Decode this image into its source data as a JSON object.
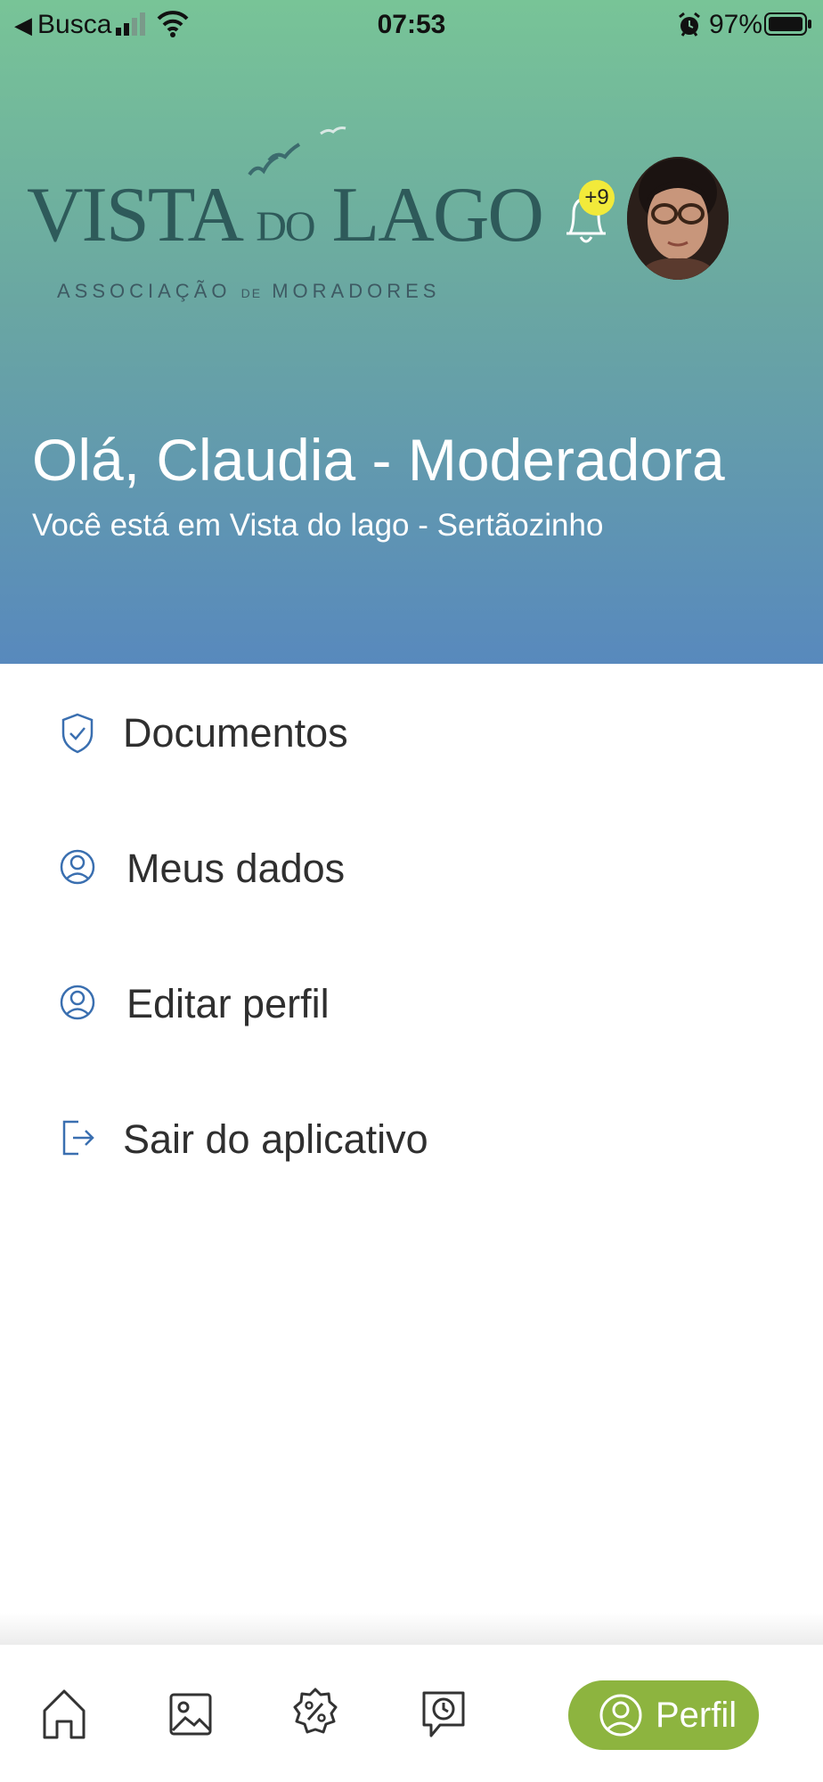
{
  "status_bar": {
    "back_glyph": "◀",
    "carrier": "Busca",
    "time": "07:53",
    "battery": "97%",
    "icons": [
      "signal-icon",
      "wifi-icon",
      "alarm-icon",
      "battery-icon"
    ]
  },
  "header": {
    "logo": {
      "title_a": "VISTA",
      "title_do": "DO",
      "title_b": "LAGO",
      "sub_a": "ASSOCIAÇÃO",
      "sub_de": "DE",
      "sub_b": "MORADORES"
    },
    "notifications_badge": "+9",
    "greeting": "Olá, Claudia - Moderadora",
    "location": "Você está em Vista do lago - Sertãozinho"
  },
  "menu": {
    "items": [
      {
        "label": "Documentos",
        "icon": "shield-check-icon"
      },
      {
        "label": "Meus dados",
        "icon": "user-circle-icon"
      },
      {
        "label": "Editar perfil",
        "icon": "user-circle-icon"
      },
      {
        "label": "Sair do aplicativo",
        "icon": "logout-icon"
      }
    ]
  },
  "bottom_nav": {
    "items": [
      {
        "icon": "home-icon"
      },
      {
        "icon": "gallery-icon"
      },
      {
        "icon": "discount-badge-icon"
      },
      {
        "icon": "chat-clock-icon"
      }
    ],
    "active_label": "Perfil",
    "active_icon": "profile-icon"
  },
  "colors": {
    "header_top": "#78c497",
    "header_bottom": "#5889bd",
    "icon_blue": "#3a6fb0",
    "active_pill": "#8db43f",
    "badge": "#f2ea3a"
  }
}
